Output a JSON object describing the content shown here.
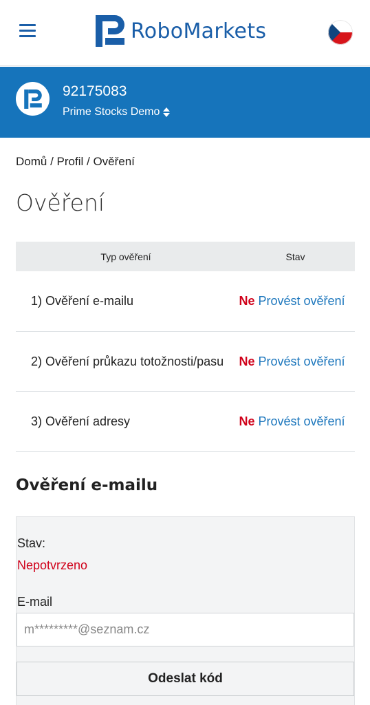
{
  "header": {
    "menu_icon": "hamburger-menu-icon",
    "logo_text": "RoboMarkets",
    "language_flag": "czech-flag-icon",
    "brand_color": "#1a5ea8"
  },
  "account": {
    "number": "92175083",
    "type": "Prime Stocks Demo",
    "bar_color": "#1674bb"
  },
  "breadcrumb": {
    "items": [
      "Domů",
      "Profil",
      "Ověření"
    ],
    "separator": " / "
  },
  "page_title": "Ověření",
  "table": {
    "headers": [
      "Typ ověření",
      "Stav"
    ],
    "rows": [
      {
        "name": "1) Ověření e-mailu",
        "status": "Ne",
        "action": "Provést ověření"
      },
      {
        "name": "2) Ověření průkazu totožnosti/pasu",
        "status": "Ne",
        "action": "Provést ověření"
      },
      {
        "name": "3) Ověření adresy",
        "status": "Ne",
        "action": "Provést ověření"
      }
    ]
  },
  "email_section": {
    "title": "Ověření e-mailu",
    "status_label": "Stav:",
    "status_value": "Nepotvrzeno",
    "email_label": "E-mail",
    "email_value": "m*********@seznam.cz",
    "send_button": "Odeslat kód"
  },
  "colors": {
    "negative": "#d0021b",
    "link": "#1a75bc"
  }
}
